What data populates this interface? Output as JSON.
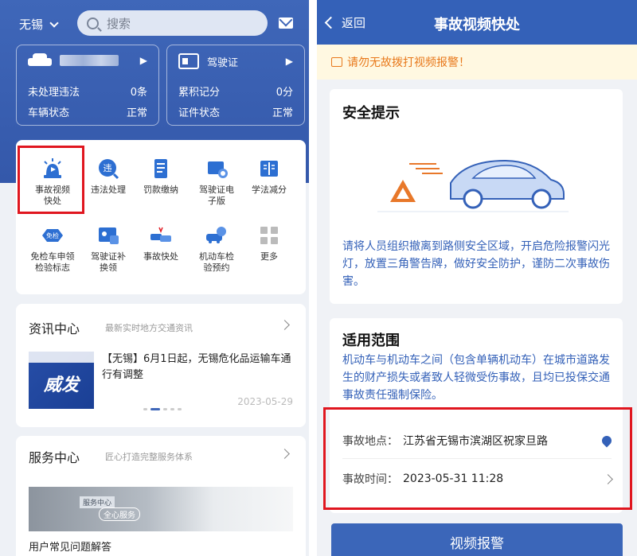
{
  "left": {
    "city": "无锡",
    "search_placeholder": "搜索",
    "vehicle": {
      "plate": "",
      "violations_label": "未处理违法",
      "violations_value": "0条",
      "status_label": "车辆状态",
      "status_value": "正常"
    },
    "license": {
      "title": "驾驶证",
      "points_label": "累积记分",
      "points_value": "0分",
      "status_label": "证件状态",
      "status_value": "正常"
    },
    "services": [
      "事故视频快处",
      "违法处理",
      "罚款缴纳",
      "驾驶证电子版",
      "学法减分",
      "免检车申领检验标志",
      "驾驶证补换领",
      "事故快处",
      "机动车检验预约",
      "更多"
    ],
    "service_icon_texts": {
      "violation": "违",
      "exempt": "免检"
    },
    "news": {
      "title": "资讯中心",
      "subtitle": "最新实时地方交通资讯",
      "image_text": "威发",
      "headline": "【无锡】6月1日起，无锡危化品运输车通行有调整",
      "date": "2023-05-29"
    },
    "service_center": {
      "title": "服务中心",
      "subtitle": "匠心打造完整服务体系",
      "tag1": "服务中心",
      "tag2": "全心服务",
      "caption": "用户常见问题解答"
    }
  },
  "right": {
    "back_label": "返回",
    "title": "事故视频快处",
    "notice": "请勿无故拨打视频报警！",
    "safety": {
      "heading": "安全提示",
      "text": "请将人员组织撤离到路侧安全区域，开启危险报警闪光灯，放置三角警告牌，做好安全防护，谨防二次事故伤害。"
    },
    "scope": {
      "heading": "适用范围",
      "text": "机动车与机动车之间（包含单辆机动车）在城市道路发生的财产损失或者致人轻微受伤事故，且均已投保交通事故责任强制保险。"
    },
    "location_label": "事故地点：",
    "location_value": "江苏省无锡市滨湖区祝家旦路",
    "time_label": "事故时间：",
    "time_value": "2023-05-31 11:28",
    "button": "视频报警"
  }
}
